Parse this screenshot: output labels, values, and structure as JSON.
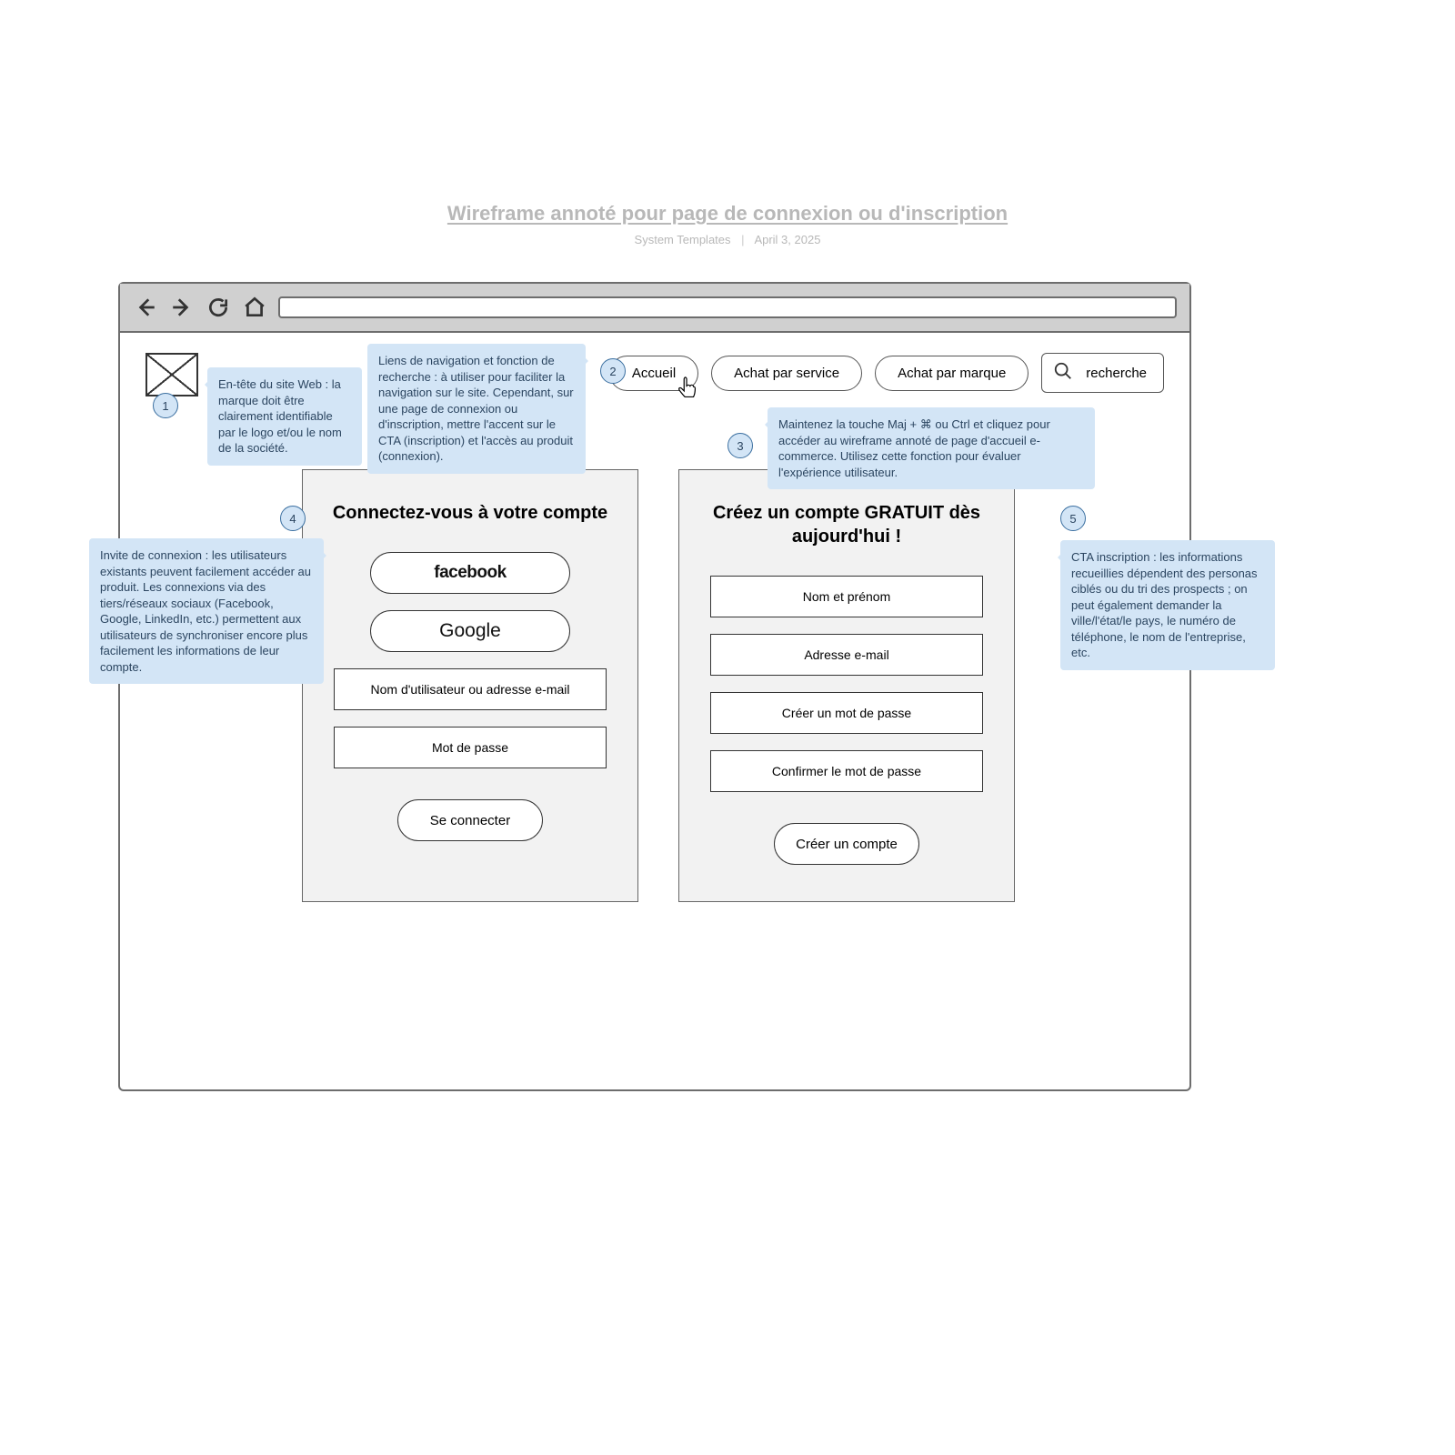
{
  "doc": {
    "title": "Wireframe annoté pour page de connexion ou d'inscription",
    "author": "System Templates",
    "date": "April 3, 2025"
  },
  "nav": {
    "items": [
      "Accueil",
      "Achat par service",
      "Achat par marque"
    ],
    "search_placeholder": "recherche"
  },
  "login_panel": {
    "title": "Connectez-vous à votre compte",
    "facebook": "facebook",
    "google": "Google",
    "username": "Nom d'utilisateur ou adresse e-mail",
    "password": "Mot de passe",
    "submit": "Se connecter"
  },
  "signup_panel": {
    "title": "Créez un compte GRATUIT dès aujourd'hui !",
    "fullname": "Nom et prénom",
    "email": "Adresse e-mail",
    "new_password": "Créer un mot de passe",
    "confirm_password": "Confirmer le mot de passe",
    "submit": "Créer un compte"
  },
  "annotations": {
    "n1": "En-tête du site Web : la marque doit être clairement identifiable par le logo et/ou le nom de la société.",
    "n2": "Liens de navigation et fonction de recherche : à utiliser pour faciliter la navigation sur le site. Cependant, sur une page de connexion ou d'inscription, mettre l'accent sur le CTA (inscription) et l'accès au produit (connexion).",
    "n3": "Maintenez la touche Maj + ⌘ ou Ctrl et cliquez pour accéder au wireframe annoté de page d'accueil e-commerce. Utilisez cette fonction pour évaluer l'expérience utilisateur.",
    "n4": "Invite de connexion : les utilisateurs existants peuvent facilement accéder au produit. Les connexions via des tiers/réseaux sociaux (Facebook, Google, LinkedIn, etc.) permettent aux utilisateurs de synchroniser encore plus facilement les informations de leur compte.",
    "n5": "CTA inscription : les informations recueillies dépendent des personas ciblés ou du tri des prospects ; on peut également demander la ville/l'état/le pays, le numéro de téléphone, le nom de l'entreprise, etc."
  },
  "bubbles": {
    "b1": "1",
    "b2": "2",
    "b3": "3",
    "b4": "4",
    "b5": "5"
  }
}
